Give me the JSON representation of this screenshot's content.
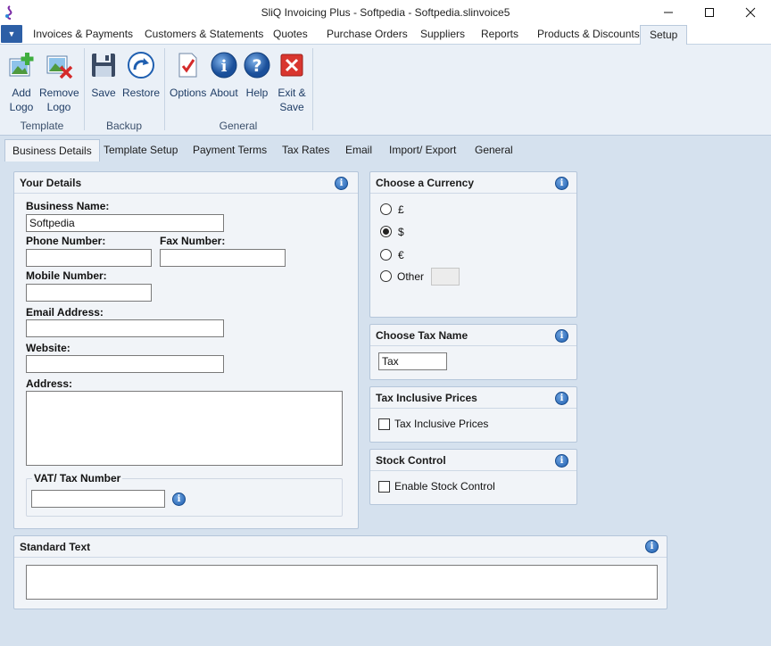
{
  "window": {
    "title": "SliQ Invoicing Plus - Softpedia - Softpedia.slinvoice5"
  },
  "menu_tabs": [
    "Invoices & Payments",
    "Customers & Statements",
    "Quotes",
    "Purchase Orders",
    "Suppliers",
    "Reports",
    "Products & Discounts",
    "Setup"
  ],
  "ribbon": {
    "add_logo_1": "Add",
    "add_logo_2": "Logo",
    "remove_logo_1": "Remove",
    "remove_logo_2": "Logo",
    "template_group": "Template",
    "save": "Save",
    "restore": "Restore",
    "backup_group": "Backup",
    "options": "Options",
    "about": "About",
    "help": "Help",
    "exit_1": "Exit &",
    "exit_2": "Save",
    "general_group": "General"
  },
  "sub_tabs": [
    "Business Details",
    "Template Setup",
    "Payment Terms",
    "Tax Rates",
    "Email",
    "Import/ Export",
    "General"
  ],
  "your_details": {
    "title": "Your Details",
    "business_name_label": "Business Name:",
    "business_name_value": "Softpedia",
    "phone_label": "Phone Number:",
    "fax_label": "Fax Number:",
    "mobile_label": "Mobile Number:",
    "email_label": "Email Address:",
    "website_label": "Website:",
    "address_label": "Address:",
    "vat_label": "VAT/ Tax Number"
  },
  "currency": {
    "title": "Choose a Currency",
    "options": [
      "£",
      "$",
      "€",
      "Other"
    ],
    "selected": "$"
  },
  "tax_name": {
    "title": "Choose Tax Name",
    "value": "Tax"
  },
  "tax_inclusive": {
    "title": "Tax Inclusive Prices",
    "checkbox_label": "Tax Inclusive Prices"
  },
  "stock_control": {
    "title": "Stock Control",
    "checkbox_label": "Enable Stock Control"
  },
  "standard_text": {
    "title": "Standard Text"
  },
  "icons": {
    "info": "i",
    "help": "?",
    "app_menu": "▼"
  },
  "colors": {
    "accent": "#2d5fa6",
    "panel_bg": "#f1f4f8",
    "window_bg": "#d5e1ee"
  }
}
